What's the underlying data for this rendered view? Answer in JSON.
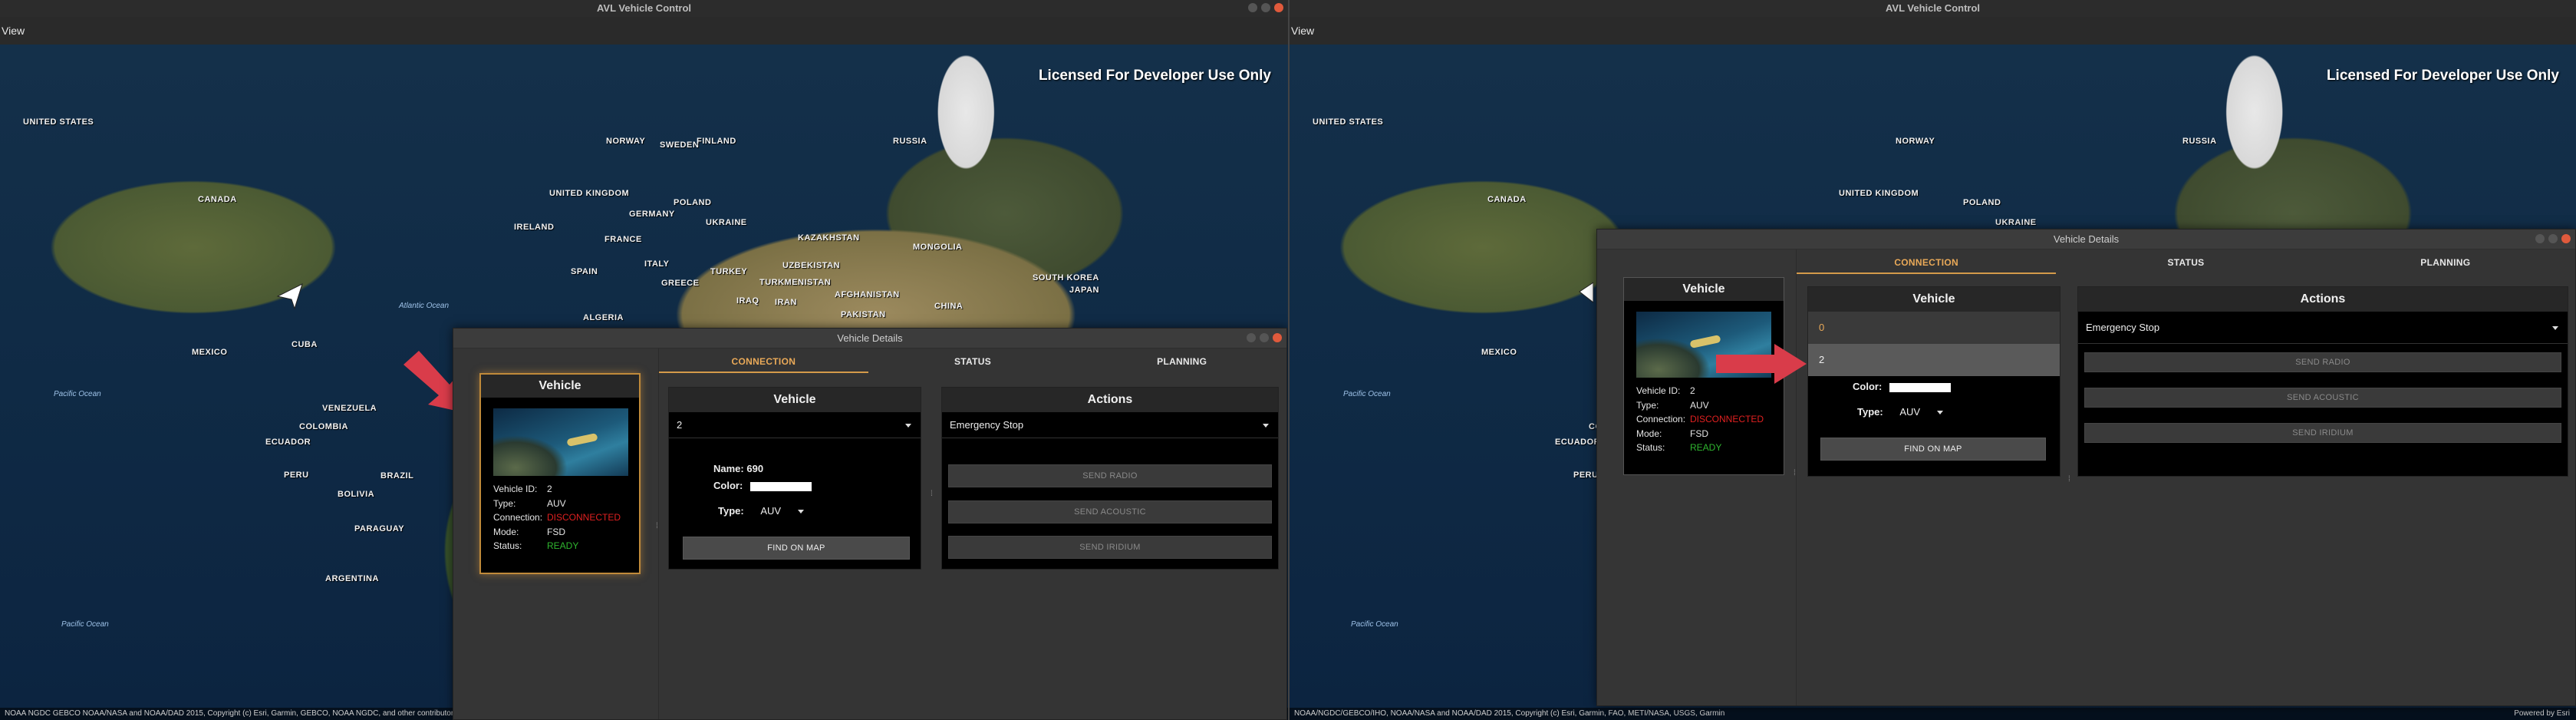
{
  "window": {
    "title": "AVL Vehicle Control"
  },
  "menubar": {
    "view": "View"
  },
  "map": {
    "license": "Licensed For Developer Use Only",
    "attribution": "NOAA NGDC GEBCO NOAA/NASA and NOAA/DAD 2015, Copyright (c) Esri, Garmin, GEBCO, NOAA NGDC, and other contributors",
    "attribution_short": "NOAA/NGDC/GEBCO/IHO, NOAA/NASA and NOAA/DAD 2015, Copyright (c) Esri, Garmin, FAO, METI/NASA, USGS, Garmin",
    "powered": "Powered by Esri",
    "labels": [
      "UNITED STATES",
      "CANADA",
      "UNITED KINGDOM",
      "IRELAND",
      "NORWAY",
      "SWEDEN",
      "FINLAND",
      "RUSSIA",
      "GERMANY",
      "POLAND",
      "UKRAINE",
      "FRANCE",
      "SPAIN",
      "ITALY",
      "TURKEY",
      "GREECE",
      "KAZAKHSTAN",
      "UZBEKISTAN",
      "TURKMENISTAN",
      "MONGOLIA",
      "CHINA",
      "JAPAN",
      "SOUTH KOREA",
      "IRAN",
      "IRAQ",
      "AFGHANISTAN",
      "PAKISTAN",
      "MEXICO",
      "CUBA",
      "VENEZUELA",
      "COLOMBIA",
      "ECUADOR",
      "PERU",
      "BRAZIL",
      "BOLIVIA",
      "PARAGUAY",
      "ARGENTINA",
      "ALGERIA"
    ],
    "oceans": [
      "Pacific Ocean",
      "Atlantic Ocean",
      "Pacific Ocean"
    ]
  },
  "details": {
    "title": "Vehicle Details",
    "vehicle_card": {
      "header": "Vehicle",
      "fields": [
        {
          "key": "Vehicle ID:",
          "value": "2"
        },
        {
          "key": "Type:",
          "value": "AUV"
        },
        {
          "key": "Connection:",
          "value": "DISCONNECTED"
        },
        {
          "key": "Mode:",
          "value": "FSD"
        },
        {
          "key": "Status:",
          "value": "READY"
        }
      ]
    },
    "tabs": [
      "CONNECTION",
      "STATUS",
      "PLANNING"
    ],
    "vehicle_panel": {
      "header": "Vehicle",
      "selected": "2",
      "name_label": "Name:",
      "name_value": "690",
      "color_label": "Color:",
      "type_label": "Type:",
      "type_value": "AUV",
      "find_button": "FIND ON MAP",
      "dropdown_options": [
        "0",
        "2"
      ]
    },
    "actions_panel": {
      "header": "Actions",
      "selected": "Emergency Stop",
      "buttons": [
        "SEND RADIO",
        "SEND ACOUSTIC",
        "SEND IRIDIUM"
      ]
    }
  },
  "colors": {
    "accent": "#e9a958",
    "danger": "#e02020",
    "ok": "#2fb52f",
    "arrow": "#d93c4a"
  }
}
